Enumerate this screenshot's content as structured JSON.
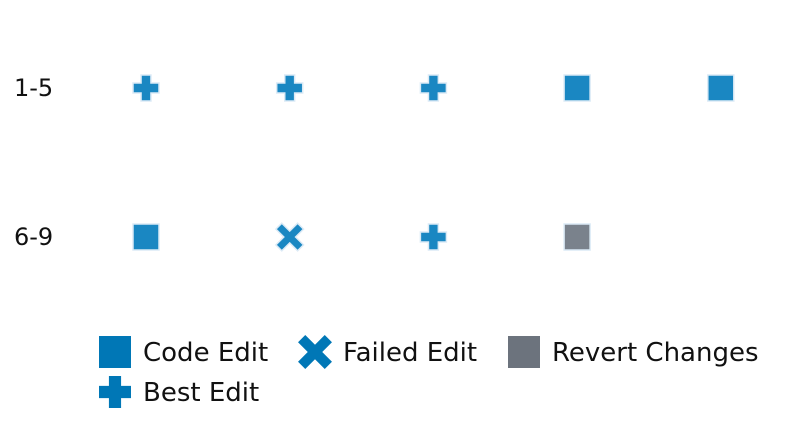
{
  "chart_data": {
    "type": "scatter",
    "title": "",
    "xlabel": "",
    "ylabel": "",
    "grid": false,
    "rows": [
      {
        "label": "1-5",
        "steps": [
          "best_edit",
          "best_edit",
          "best_edit",
          "code_edit",
          "code_edit"
        ]
      },
      {
        "label": "6-9",
        "steps": [
          "code_edit",
          "failed_edit",
          "best_edit",
          "revert_changes"
        ]
      }
    ],
    "legend": {
      "placement": "bottom",
      "items": [
        {
          "key": "code_edit",
          "label": "Code Edit"
        },
        {
          "key": "failed_edit",
          "label": "Failed Edit"
        },
        {
          "key": "revert_changes",
          "label": "Revert Changes"
        },
        {
          "key": "best_edit",
          "label": "Best Edit"
        }
      ]
    },
    "styles": {
      "code_edit": {
        "shape": "square",
        "color": "#1a87c2",
        "legend_color": "#0077b6"
      },
      "failed_edit": {
        "shape": "x",
        "color": "#1a87c2",
        "legend_color": "#0077b6"
      },
      "revert_changes": {
        "shape": "square",
        "color": "#7a828c",
        "legend_color": "#6c737d"
      },
      "best_edit": {
        "shape": "plus",
        "color": "#1a87c2",
        "legend_color": "#0077b6"
      }
    }
  }
}
